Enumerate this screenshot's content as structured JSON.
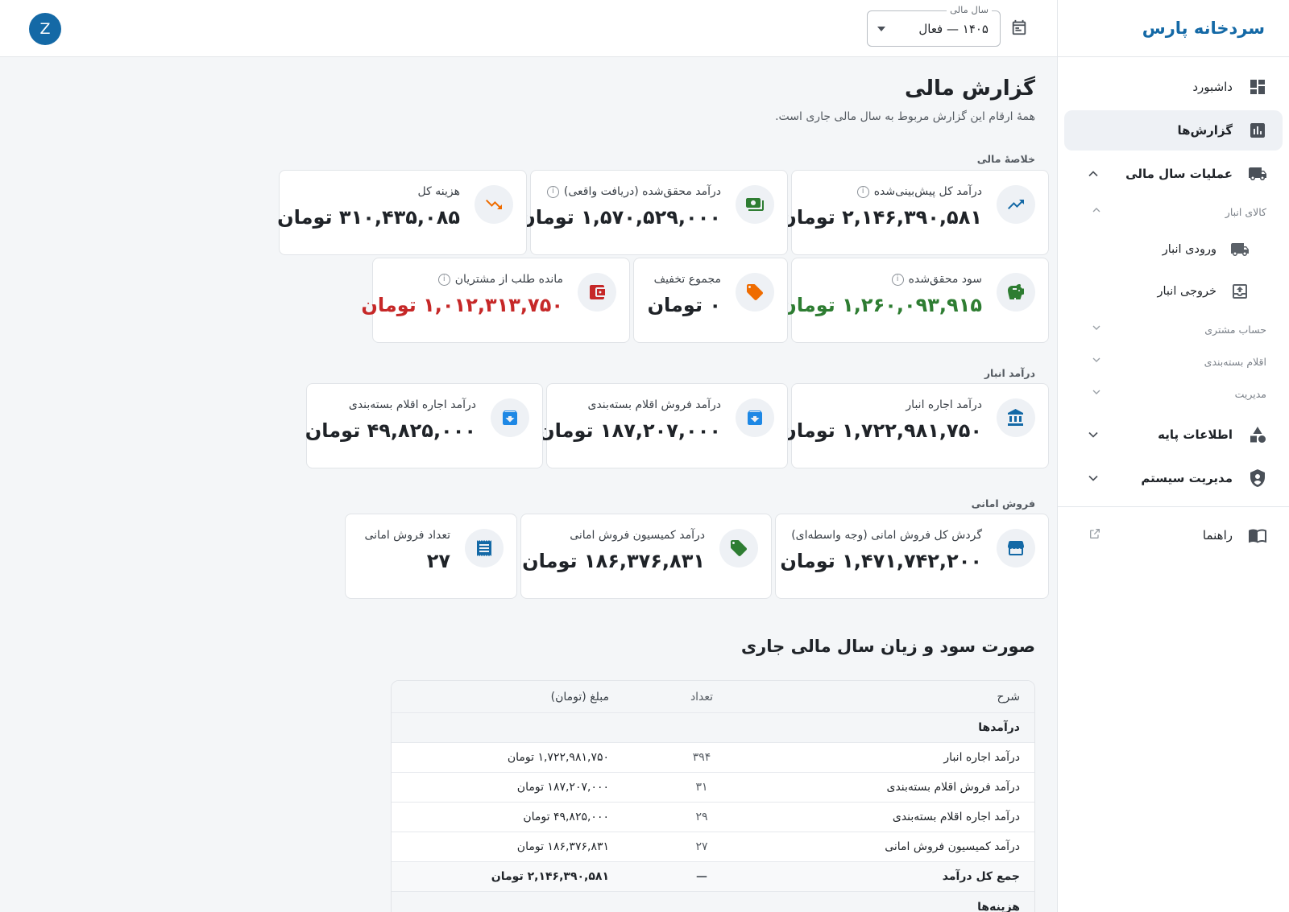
{
  "app": {
    "brand": "سردخانه پارس"
  },
  "topbar": {
    "fy_label": "سال مالی",
    "fy_value": "۱۴۰۵ — فعال",
    "avatar": "Z"
  },
  "sidebar": {
    "dashboard": "داشبورد",
    "reports": "گزارش‌ها",
    "fy_ops": "عملیات سال مالی",
    "warehouse_goods": "کالای انبار",
    "warehouse_in": "ورودی انبار",
    "warehouse_out": "خروجی انبار",
    "customer_account": "حساب مشتری",
    "packaging_items": "اقلام بسته‌بندی",
    "management": "مدیریت",
    "base_info": "اطلاعات پایه",
    "system_admin": "مدیریت سیستم",
    "help": "راهنما"
  },
  "page": {
    "title": "گزارش مالی",
    "subtitle": "همهٔ ارقام این گزارش مربوط به سال مالی جاری است."
  },
  "summary": {
    "label": "خلاصهٔ مالی",
    "projected_income": {
      "label": "درآمد کل پیش‌بینی‌شده",
      "value": "۲,۱۴۶,۳۹۰,۵۸۱ تومان"
    },
    "realized_income": {
      "label": "درآمد محقق‌شده (دریافت واقعی)",
      "value": "۱,۵۷۰,۵۲۹,۰۰۰ تومان"
    },
    "total_expense": {
      "label": "هزینه کل",
      "value": "۳۱۰,۴۳۵,۰۸۵ تومان"
    },
    "realized_profit": {
      "label": "سود محقق‌شده",
      "value": "۱,۲۶۰,۰۹۳,۹۱۵ تومان"
    },
    "total_discount": {
      "label": "مجموع تخفیف",
      "value": "۰ تومان"
    },
    "receivables": {
      "label": "مانده طلب از مشتریان",
      "value": "۱,۰۱۲,۳۱۳,۷۵۰ تومان"
    }
  },
  "warehouse_income": {
    "label": "درآمد انبار",
    "rent": {
      "label": "درآمد اجاره انبار",
      "value": "۱,۷۲۲,۹۸۱,۷۵۰ تومان"
    },
    "pack_sale": {
      "label": "درآمد فروش اقلام بسته‌بندی",
      "value": "۱۸۷,۲۰۷,۰۰۰ تومان"
    },
    "pack_rent": {
      "label": "درآمد اجاره اقلام بسته‌بندی",
      "value": "۴۹,۸۲۵,۰۰۰ تومان"
    }
  },
  "consignment": {
    "label": "فروش امانی",
    "turnover": {
      "label": "گردش کل فروش امانی (وجه واسطه‌ای)",
      "value": "۱,۴۷۱,۷۴۲,۲۰۰ تومان"
    },
    "commission": {
      "label": "درآمد کمیسیون فروش امانی",
      "value": "۱۸۶,۳۷۶,۸۳۱ تومان"
    },
    "count": {
      "label": "تعداد فروش امانی",
      "value": "۲۷"
    }
  },
  "pl": {
    "title": "صورت سود و زیان سال مالی جاری",
    "headers": {
      "desc": "شرح",
      "count": "تعداد",
      "amount": "مبلغ (تومان)"
    },
    "income_section": "درآمدها",
    "rows": [
      {
        "desc": "درآمد اجاره انبار",
        "count": "۳۹۴",
        "amount": "۱,۷۲۲,۹۸۱,۷۵۰ تومان"
      },
      {
        "desc": "درآمد فروش اقلام بسته‌بندی",
        "count": "۳۱",
        "amount": "۱۸۷,۲۰۷,۰۰۰ تومان"
      },
      {
        "desc": "درآمد اجاره اقلام بسته‌بندی",
        "count": "۲۹",
        "amount": "۴۹,۸۲۵,۰۰۰ تومان"
      },
      {
        "desc": "درآمد کمیسیون فروش امانی",
        "count": "۲۷",
        "amount": "۱۸۶,۳۷۶,۸۳۱ تومان"
      }
    ],
    "total": {
      "desc": "جمع کل درآمد",
      "count": "—",
      "amount": "۲,۱۴۶,۳۹۰,۵۸۱ تومان"
    },
    "expense_section": "هزینه‌ها"
  },
  "colors": {
    "brand": "#1469a6",
    "profit": "#2e7d32",
    "receivable": "#c62828",
    "expense_icon": "#ef6c00"
  },
  "icons": {
    "dashboard": "dashboard-icon",
    "reports": "bar-chart-icon",
    "truck": "truck-icon",
    "trend_up": "trending-up-icon",
    "money": "money-icon",
    "trend_down": "trending-down-icon",
    "piggy": "savings-icon",
    "tag": "tag-icon",
    "wallet": "wallet-icon",
    "bank": "bank-icon",
    "archive": "archive-icon",
    "store": "storefront-icon",
    "receipt": "receipt-icon",
    "help": "book-icon",
    "external": "external-link-icon"
  }
}
